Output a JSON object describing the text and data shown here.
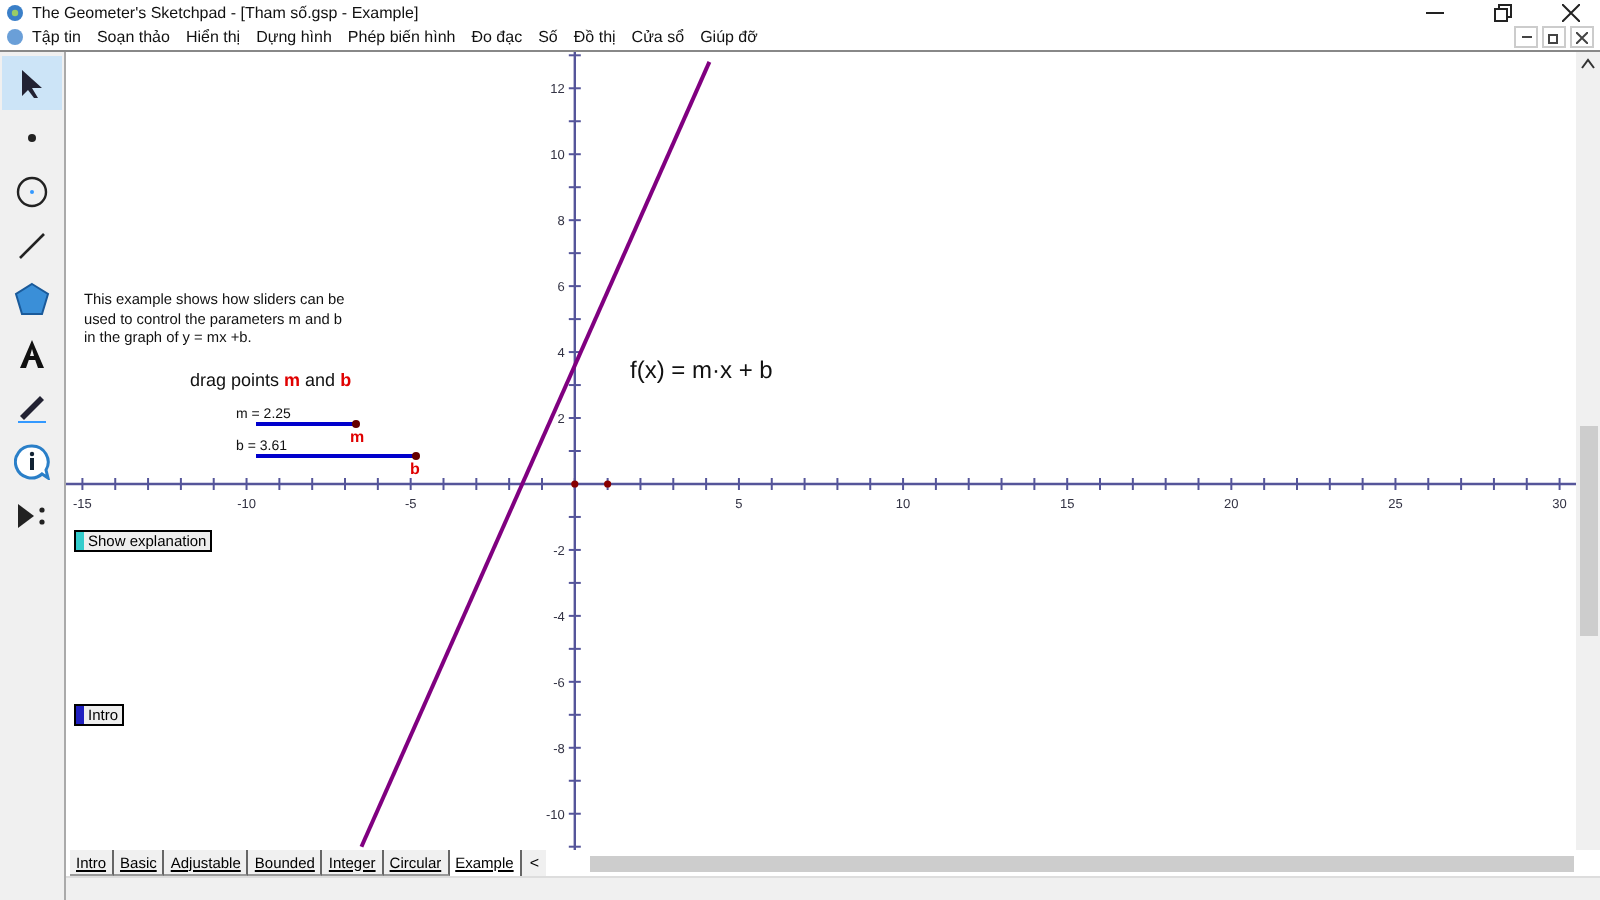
{
  "window": {
    "title": "The Geometer's Sketchpad - [Tham số.gsp - Example]"
  },
  "menu": [
    "Tập tin",
    "Soạn thảo",
    "Hiển thị",
    "Dựng hình",
    "Phép biến hình",
    "Đo đạc",
    "Số",
    "Đồ thị",
    "Cửa sổ",
    "Giúp đỡ"
  ],
  "tools": [
    {
      "kind": "arrow",
      "selected": true
    },
    {
      "kind": "point",
      "selected": false
    },
    {
      "kind": "compass",
      "selected": false
    },
    {
      "kind": "straightedge",
      "selected": false
    },
    {
      "kind": "polygon",
      "selected": false
    },
    {
      "kind": "text",
      "selected": false
    },
    {
      "kind": "marker",
      "selected": false
    },
    {
      "kind": "info",
      "selected": false
    },
    {
      "kind": "custom",
      "selected": false
    }
  ],
  "canvas": {
    "explanation": "This example shows how sliders can be\nused to control the parameters m and b\nin the graph of y = mx +b.",
    "instruction": "drag points **m** and **b**",
    "sliders": [
      {
        "reading": "m = 2.25",
        "point": "m"
      },
      {
        "reading": "b = 3.61",
        "point": "b"
      }
    ],
    "function": "f(x) = m·x + b",
    "buttons": [
      {
        "label": "Show explanation",
        "color": "#33cccc"
      },
      {
        "label": "Intro",
        "color": "#2020c0"
      }
    ],
    "chart_data": {
      "type": "line",
      "x": [
        -6.5,
        4.1
      ],
      "series": [
        {
          "color": "#800080",
          "values": [
            -11.0,
            12.8
          ]
        }
      ],
      "xlim": [
        -15.5,
        30.5
      ],
      "ylim": [
        -11.1,
        13.1
      ],
      "xticks": [
        -15,
        -10,
        -5,
        5,
        10,
        15,
        20,
        25,
        30
      ],
      "yticks": [
        -10,
        -8,
        -6,
        -4,
        -2,
        2,
        4,
        6,
        8,
        10,
        12
      ]
    }
  },
  "page_tabs": [
    {
      "label": "Intro",
      "selected": false
    },
    {
      "label": "Basic",
      "selected": false
    },
    {
      "label": "Adjustable",
      "selected": false
    },
    {
      "label": "Bounded",
      "selected": false
    },
    {
      "label": "Integer",
      "selected": false
    },
    {
      "label": "Circular",
      "selected": false
    },
    {
      "label": "Example",
      "selected": true
    }
  ],
  "tab_scroll": "<"
}
